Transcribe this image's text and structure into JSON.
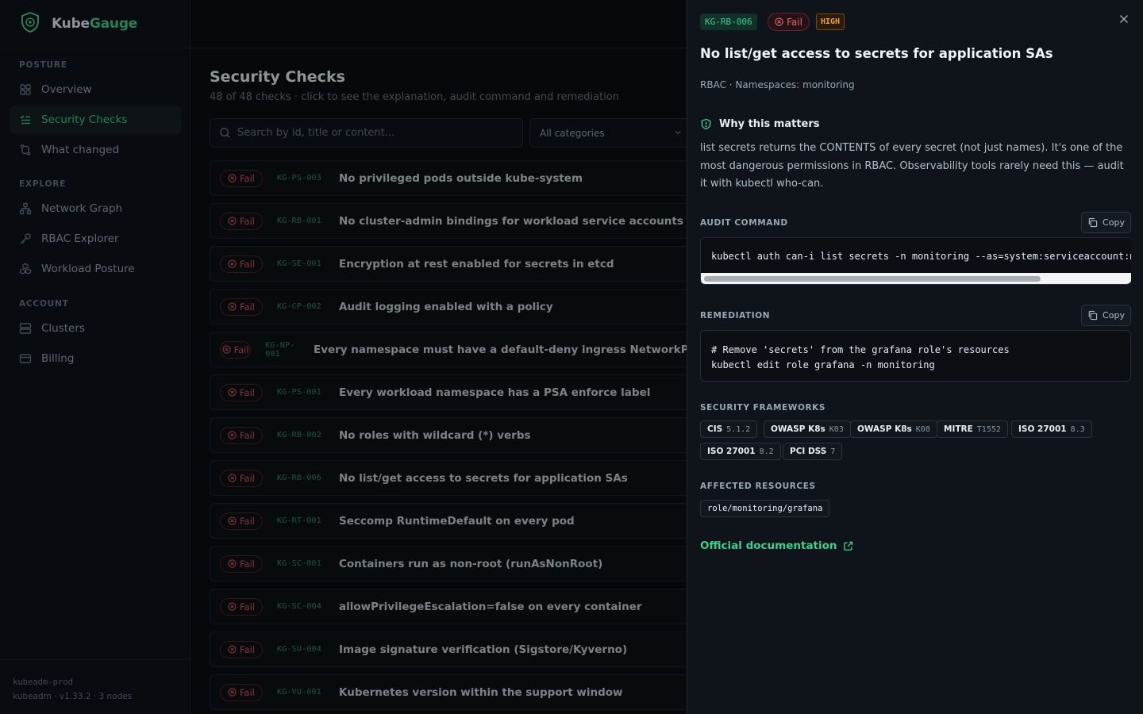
{
  "brand": {
    "name_part1": "Kube",
    "name_part2": "Gauge"
  },
  "sidebar": {
    "sections": [
      {
        "label": "POSTURE"
      },
      {
        "label": "EXPLORE"
      },
      {
        "label": "ACCOUNT"
      }
    ],
    "items": [
      {
        "label": "Overview",
        "icon": "grid-icon"
      },
      {
        "label": "Security Checks",
        "icon": "list-check-icon",
        "active": true
      },
      {
        "label": "What changed",
        "icon": "diff-icon"
      },
      {
        "label": "Network Graph",
        "icon": "network-icon"
      },
      {
        "label": "RBAC Explorer",
        "icon": "key-icon"
      },
      {
        "label": "Workload Posture",
        "icon": "boxes-icon"
      },
      {
        "label": "Clusters",
        "icon": "server-icon"
      },
      {
        "label": "Billing",
        "icon": "card-icon"
      }
    ],
    "footer": {
      "cluster": "kubeadm-prod",
      "details": "kubeadm · v1.33.2 · 3 nodes"
    }
  },
  "main": {
    "title": "Security Checks",
    "subtitle": "48 of 48 checks · click to see the explanation, audit command and remediation",
    "search_placeholder": "Search by id, title or content...",
    "category_select": "All categories",
    "fail_label": "Fail",
    "checks": [
      {
        "id": "KG-PS-003",
        "title": "No privileged pods outside kube-system"
      },
      {
        "id": "KG-RB-001",
        "title": "No cluster-admin bindings for workload service accounts"
      },
      {
        "id": "KG-SE-001",
        "title": "Encryption at rest enabled for secrets in etcd"
      },
      {
        "id": "KG-CP-002",
        "title": "Audit logging enabled with a policy"
      },
      {
        "id": "KG-NP-001",
        "title": "Every namespace must have a default-deny ingress NetworkPolicy"
      },
      {
        "id": "KG-PS-001",
        "title": "Every workload namespace has a PSA enforce label"
      },
      {
        "id": "KG-RB-002",
        "title": "No roles with wildcard (*) verbs"
      },
      {
        "id": "KG-RB-006",
        "title": "No list/get access to secrets for application SAs"
      },
      {
        "id": "KG-RT-001",
        "title": "Seccomp RuntimeDefault on every pod"
      },
      {
        "id": "KG-SC-001",
        "title": "Containers run as non-root (runAsNonRoot)"
      },
      {
        "id": "KG-SC-004",
        "title": "allowPrivilegeEscalation=false on every container"
      },
      {
        "id": "KG-SU-004",
        "title": "Image signature verification (Sigstore/Kyverno)"
      },
      {
        "id": "KG-VU-001",
        "title": "Kubernetes version within the support window"
      }
    ]
  },
  "detail": {
    "id": "KG-RB-006",
    "status": "Fail",
    "severity": "HIGH",
    "title": "No list/get access to secrets for application SAs",
    "meta": "RBAC · Namespaces: monitoring",
    "why_heading": "Why this matters",
    "why_body": "list secrets returns the CONTENTS of every secret (not just names). It's one of the most dangerous permissions in RBAC. Observability tools rarely need this — audit it with kubectl who-can.",
    "audit_label": "AUDIT COMMAND",
    "audit_command": "kubectl auth can-i list secrets -n monitoring --as=system:serviceaccount:monitoring:grafana",
    "copy_label": "Copy",
    "remediation_label": "REMEDIATION",
    "remediation_lines": [
      "# Remove 'secrets' from the grafana role's resources",
      "kubectl edit role grafana -n monitoring"
    ],
    "frameworks_label": "SECURITY FRAMEWORKS",
    "frameworks": [
      {
        "name": "CIS",
        "code": "5.1.2"
      },
      {
        "name": "OWASP K8s",
        "code": "K03"
      },
      {
        "name": "OWASP K8s",
        "code": "K08"
      },
      {
        "name": "MITRE",
        "code": "T1552"
      },
      {
        "name": "ISO 27001",
        "code": "8.3"
      },
      {
        "name": "ISO 27001",
        "code": "8.2"
      },
      {
        "name": "PCI DSS",
        "code": "7"
      }
    ],
    "affected_label": "AFFECTED RESOURCES",
    "affected_resources": [
      "role/monitoring/grafana"
    ],
    "doc_link": "Official documentation"
  },
  "colors": {
    "accent": "#3ecf8e",
    "fail": "#e26a6f",
    "high": "#f0a23a"
  }
}
